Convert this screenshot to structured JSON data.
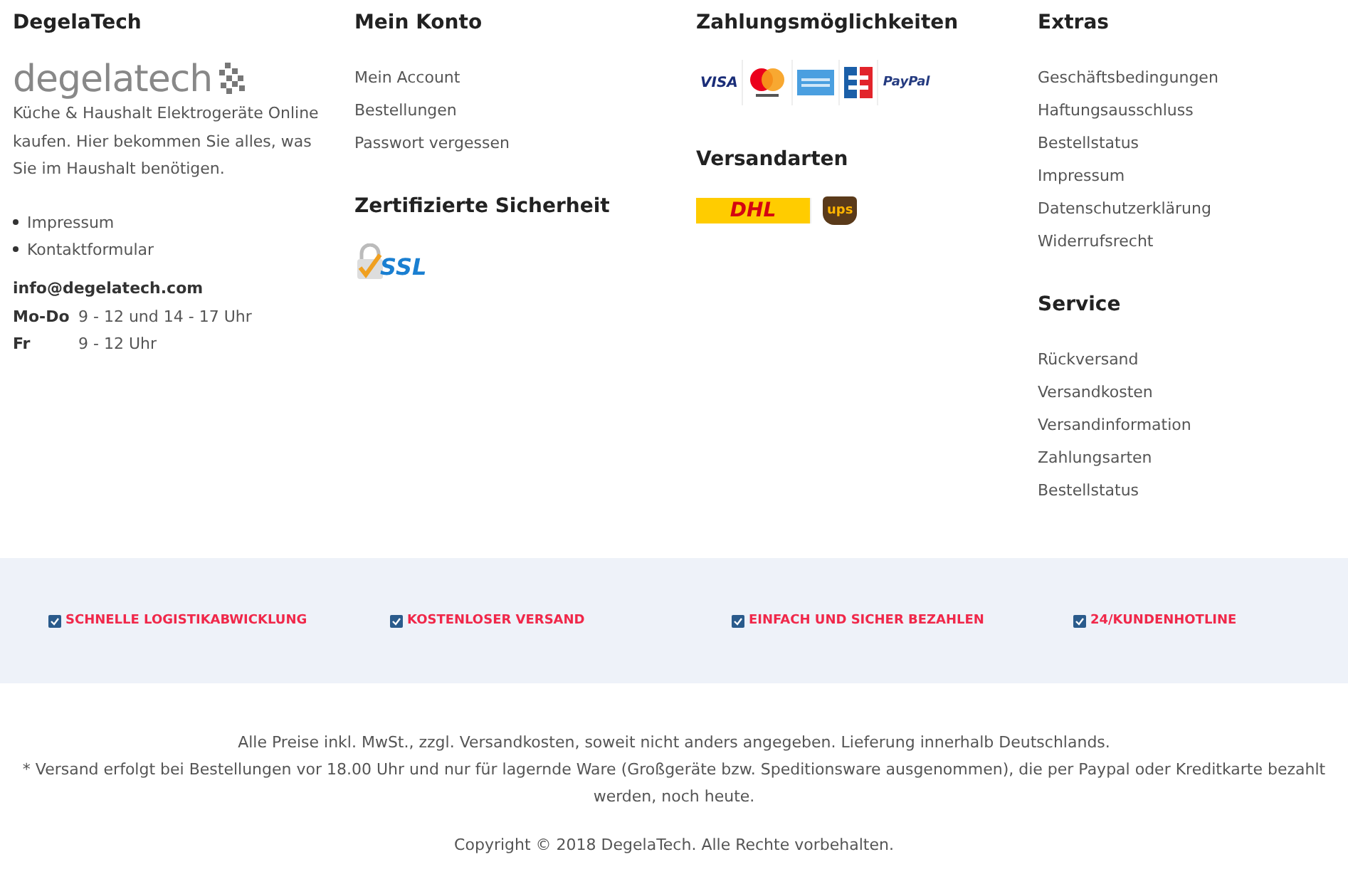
{
  "columns": [
    {
      "heading": "DegelaTech",
      "logo": "degelatech",
      "description": "Küche & Haushalt Elektrogeräte Online kaufen. Hier bekommen Sie alles, was Sie im Haushalt benötigen.",
      "bullets": [
        "Impressum",
        "Kontaktformular"
      ],
      "email": "info@degelatech.com",
      "hours": [
        {
          "days": "Mo-Do",
          "time": "9 - 12 und 14 - 17 Uhr"
        },
        {
          "days": "Fr",
          "time": "9 - 12 Uhr"
        }
      ]
    },
    {
      "sections": [
        {
          "heading": "Mein Konto",
          "links": [
            "Mein Account",
            "Bestellungen",
            "Passwort vergessen"
          ]
        },
        {
          "heading": "Zertifizierte Sicherheit",
          "badges": [
            {
              "kind": "ssl",
              "label": "SSL"
            }
          ]
        }
      ]
    },
    {
      "sections": [
        {
          "heading": "Zahlungsmöglichkeiten",
          "badges": [
            {
              "kind": "visa",
              "label": "VISA"
            },
            {
              "kind": "mastercard"
            },
            {
              "kind": "amex"
            },
            {
              "kind": "ec"
            },
            {
              "kind": "paypal",
              "label": "PayPal"
            }
          ]
        },
        {
          "heading": "Versandarten",
          "badges": [
            {
              "kind": "dhl",
              "label": "DHL"
            },
            {
              "kind": "ups",
              "label": "ups"
            }
          ]
        }
      ]
    },
    {
      "sections": [
        {
          "heading": "Extras",
          "links": [
            "Geschäftsbedingungen",
            "Haftungsausschluss",
            "Bestellstatus",
            "Impressum",
            "Datenschutzerklärung",
            "Widerrufsrecht"
          ]
        },
        {
          "heading": "Service",
          "links": [
            "Rückversand",
            "Versandkosten",
            "Versandinformation",
            "Zahlungsarten",
            "Bestellstatus"
          ]
        }
      ]
    }
  ],
  "features": [
    "SCHNELLE LOGISTIKABWICKLUNG",
    "KOSTENLOSER VERSAND",
    "EINFACH UND SICHER BEZAHLEN",
    "24/KUNDENHOTLINE"
  ],
  "notes": [
    "Alle Preise inkl. MwSt., zzgl. Versandkosten, soweit nicht anders angegeben. Lieferung innerhalb Deutschlands.",
    "* Versand erfolgt bei Bestellungen vor 18.00 Uhr und nur für lagernde Ware (Großgeräte bzw. Speditionsware ausgenommen), die per Paypal oder Kreditkarte bezahlt werden, noch heute."
  ],
  "copyright": "Copyright © 2018 DegelaTech. Alle Rechte vorbehalten."
}
